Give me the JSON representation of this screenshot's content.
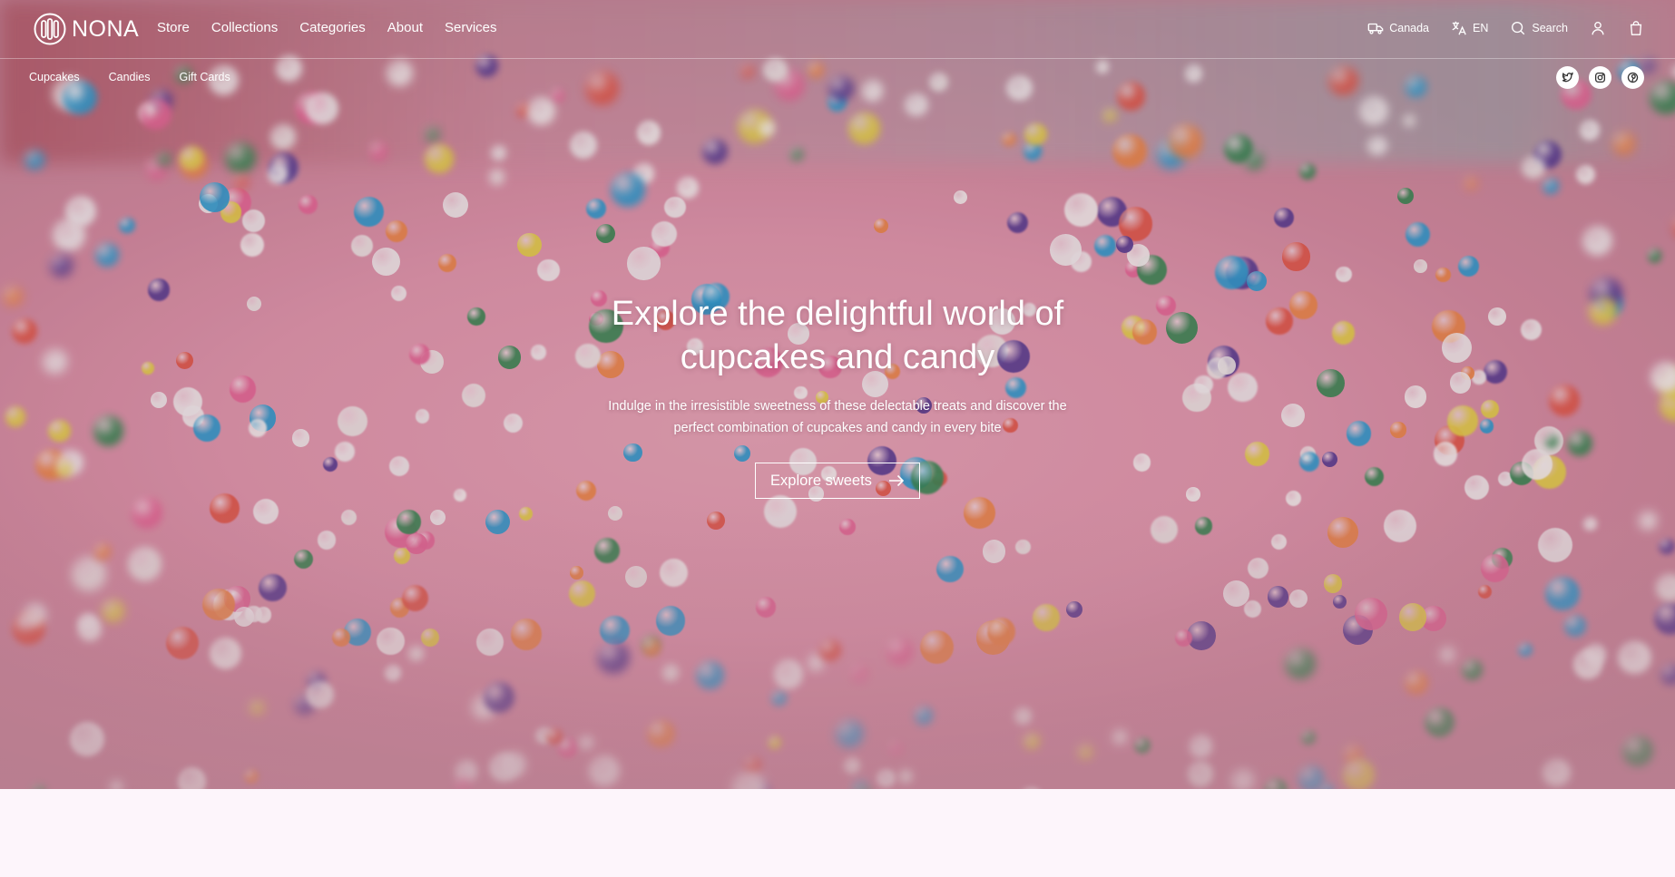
{
  "brand": {
    "name": "NONA"
  },
  "main_nav": [
    "Store",
    "Collections",
    "Categories",
    "About",
    "Services"
  ],
  "utilities": {
    "region": "Canada",
    "language": "EN",
    "search": "Search"
  },
  "sub_nav": [
    "Cupcakes",
    "Candies",
    "Gift Cards"
  ],
  "social": [
    "twitter-icon",
    "instagram-icon",
    "pinterest-icon"
  ],
  "hero": {
    "headline": "Explore the delightful world of cupcakes and candy",
    "subtext": "Indulge in the irresistible sweetness of these delectable treats and discover the perfect combination of cupcakes and candy in every bite",
    "cta": "Explore sweets"
  },
  "colors": {
    "hero_pink": "#e39aaf",
    "page_bg": "#fdf5fb",
    "text": "#ffffff"
  }
}
